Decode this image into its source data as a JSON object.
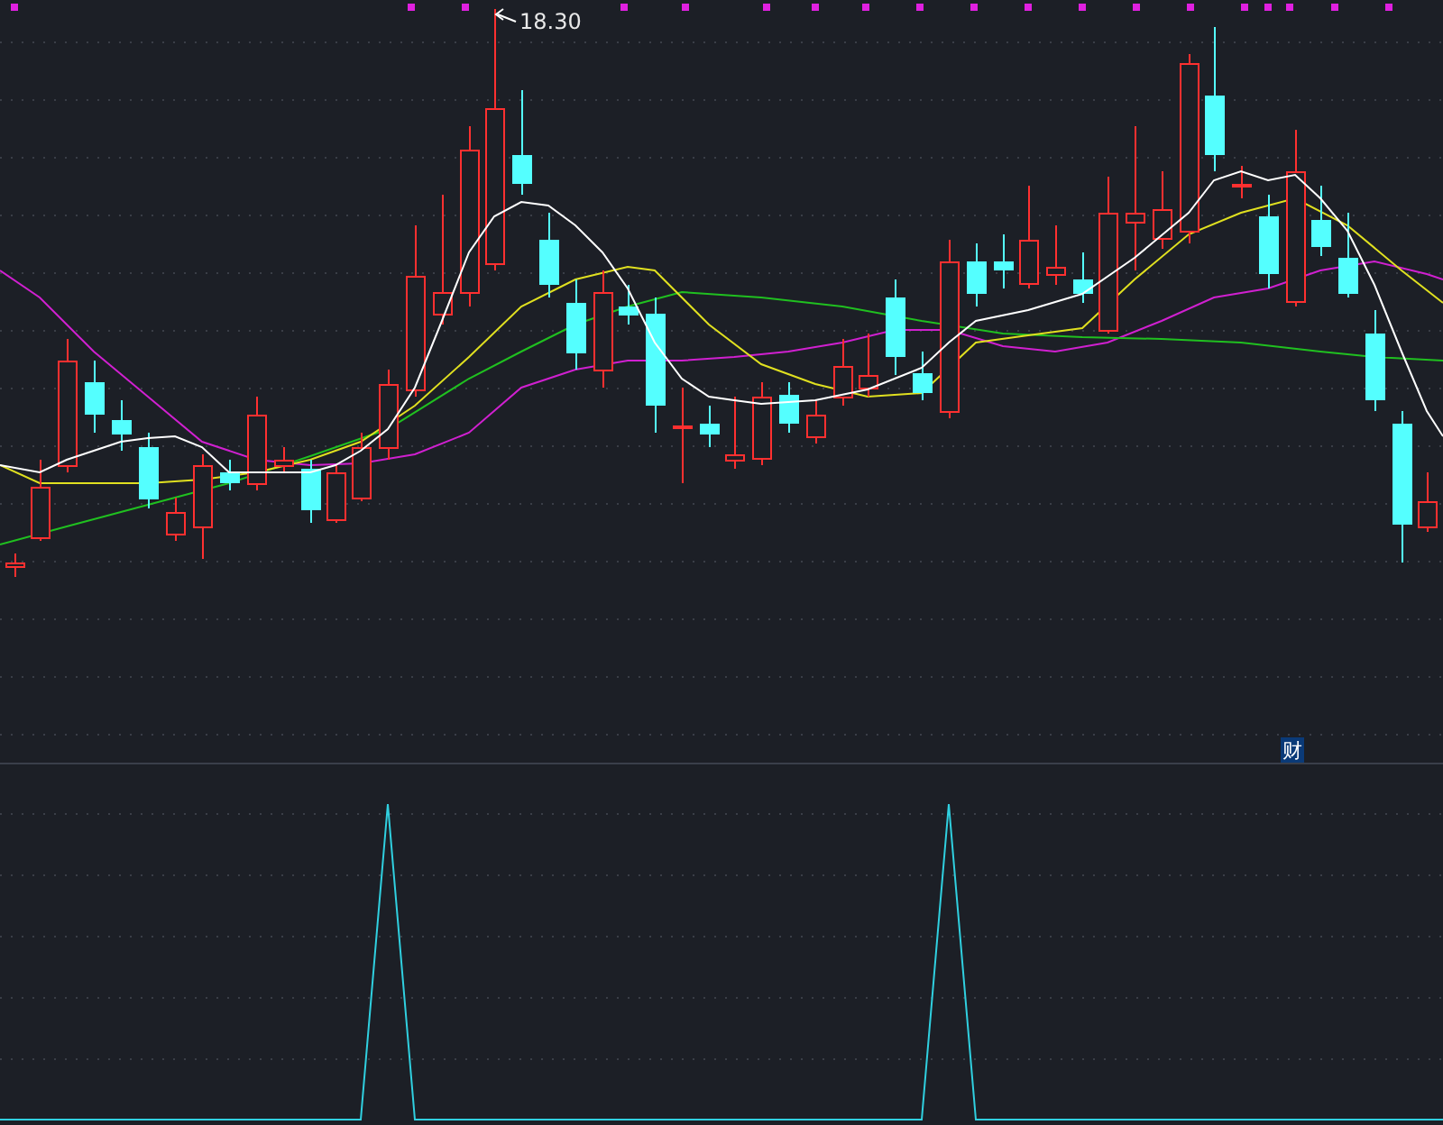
{
  "main_chart": {
    "high_label": "18.30",
    "badge": "财"
  }
}
